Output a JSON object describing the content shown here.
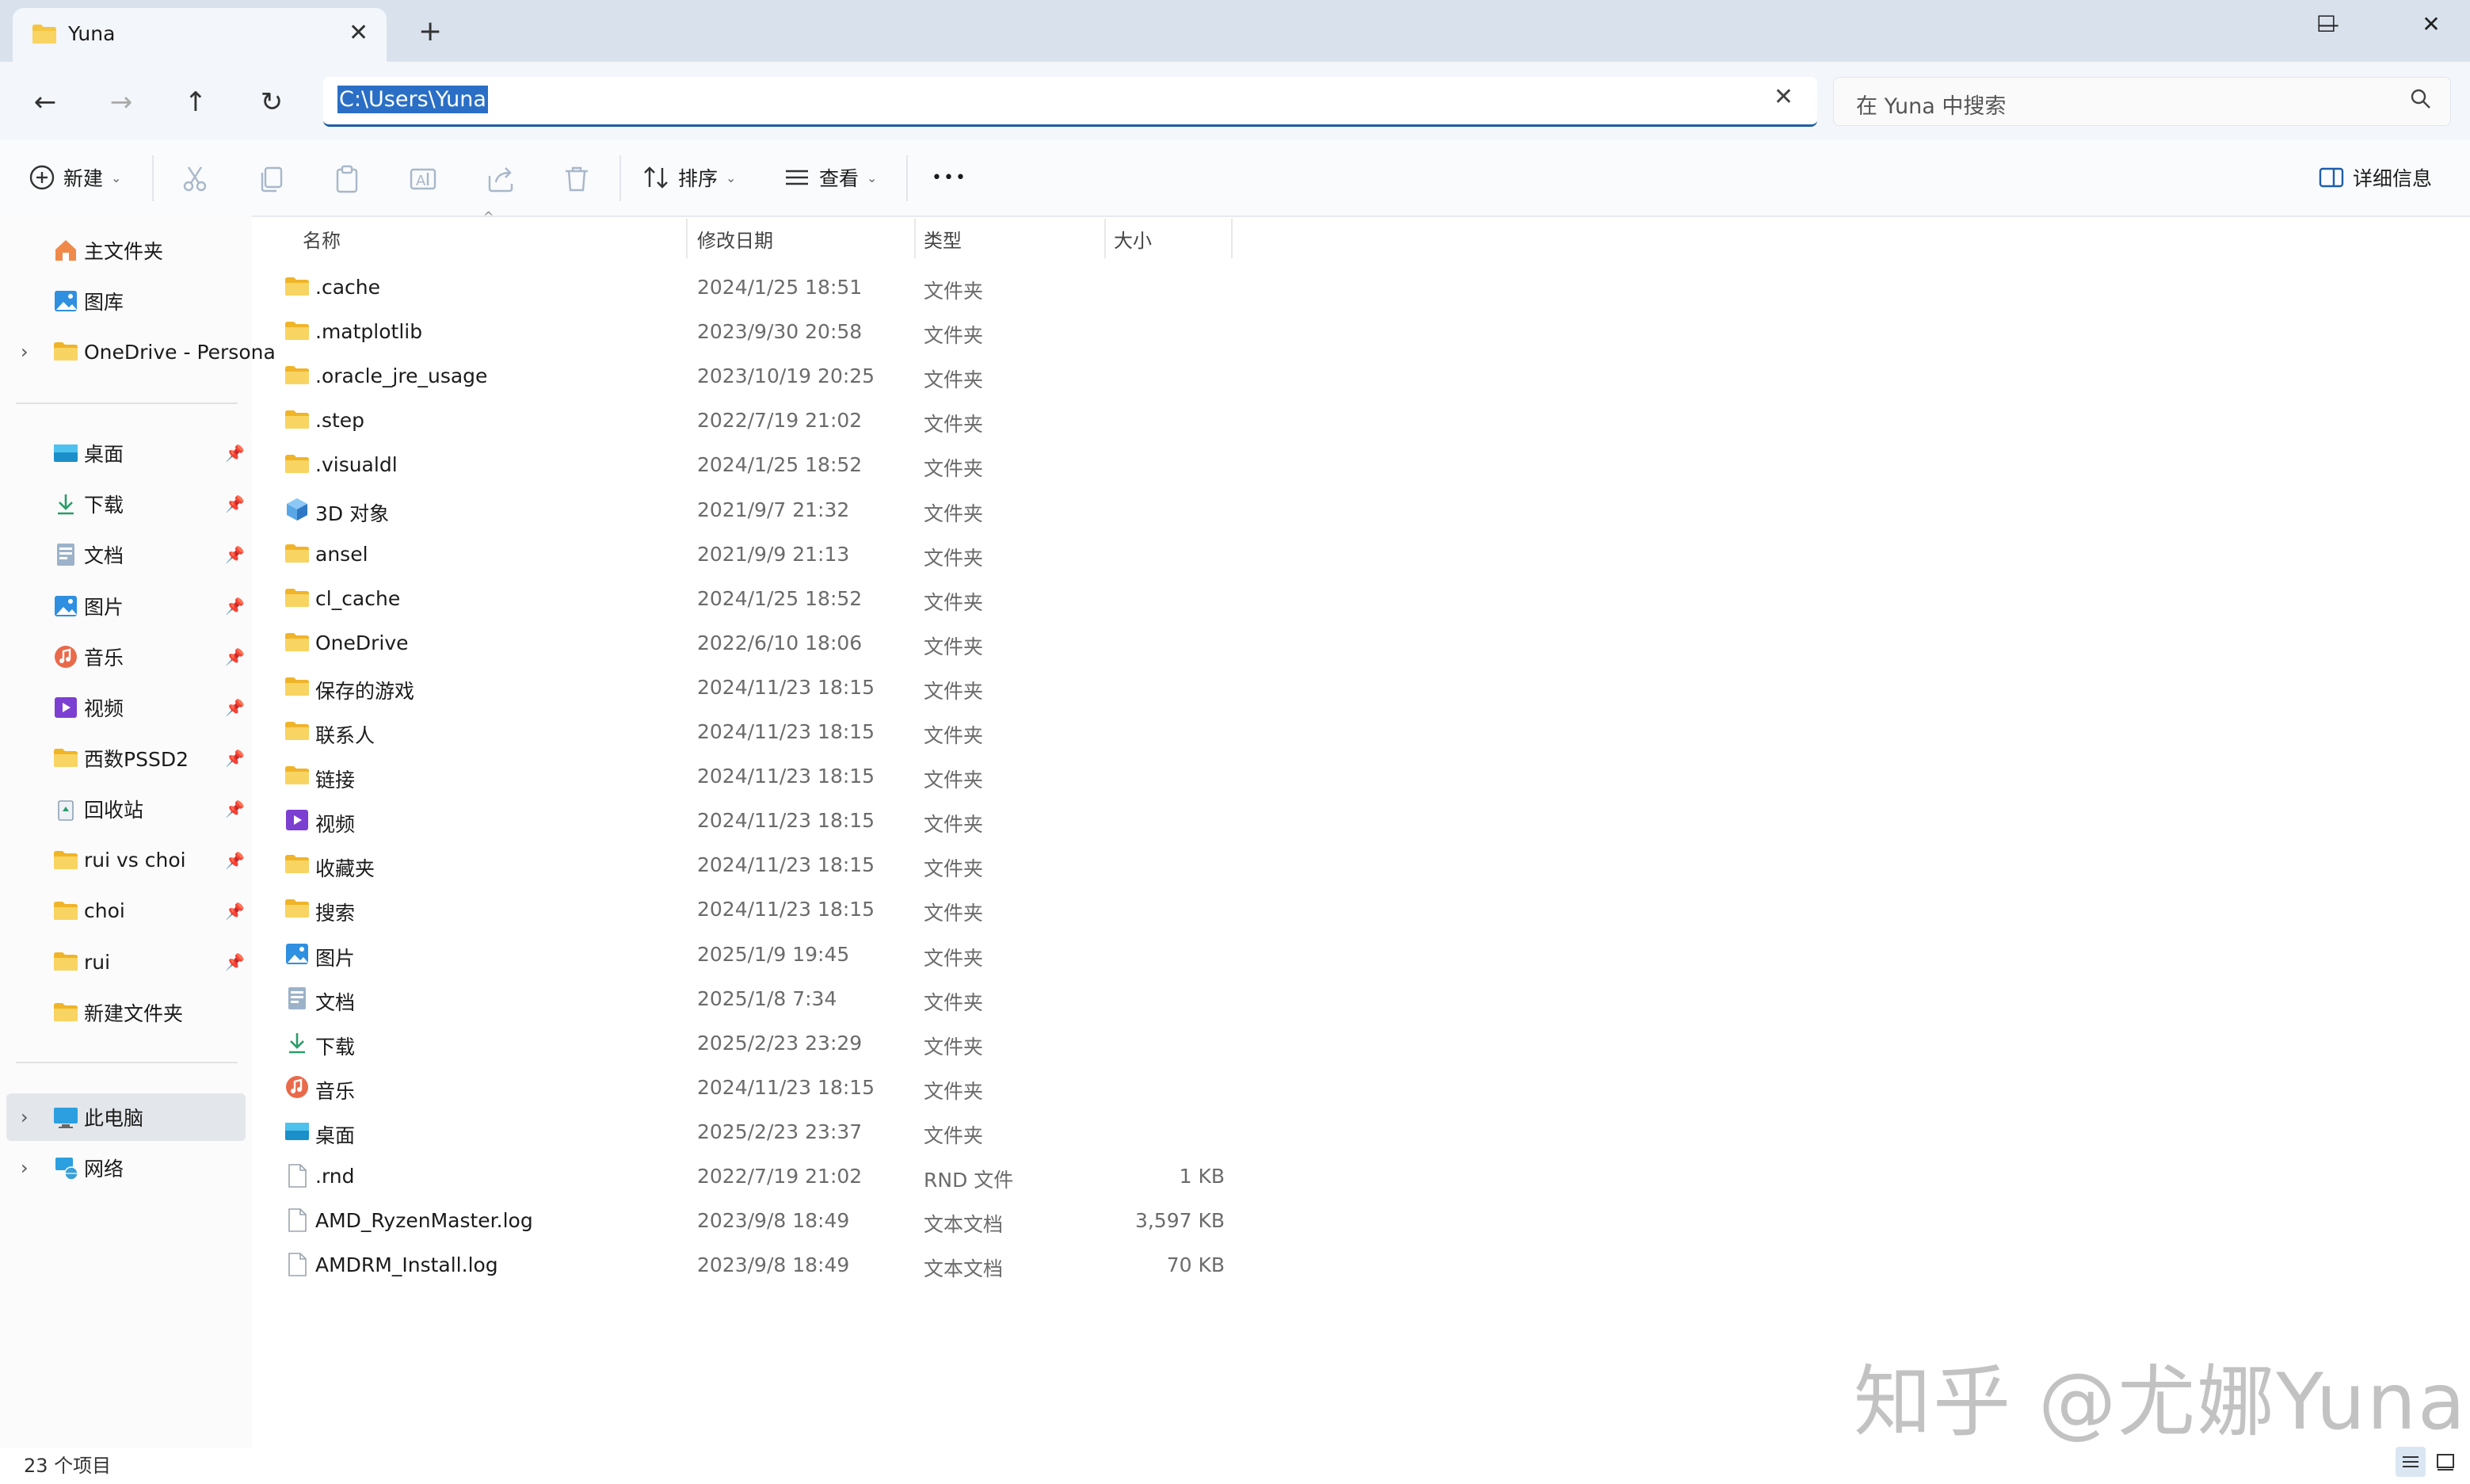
{
  "window": {
    "tab_title": "Yuna",
    "new_tab": "+",
    "tab_close": "✕",
    "minimize": "—",
    "maximize": "☐",
    "close": "✕"
  },
  "address": {
    "path": "C:\\Users\\Yuna",
    "clear": "✕",
    "search_placeholder": "在 Yuna 中搜索"
  },
  "nav": {
    "back": "←",
    "forward": "→",
    "up": "↑",
    "refresh": "↻"
  },
  "toolbar": {
    "new_label": "新建",
    "sort_label": "排序",
    "view_label": "查看",
    "more": "•••",
    "details_label": "详细信息"
  },
  "sidebar": {
    "top": [
      {
        "label": "主文件夹",
        "icon": "home-icon"
      },
      {
        "label": "图库",
        "icon": "gallery-icon"
      },
      {
        "label": "OneDrive - Persona",
        "icon": "folder-icon"
      }
    ],
    "pinned": [
      {
        "label": "桌面",
        "icon": "desktop-icon"
      },
      {
        "label": "下载",
        "icon": "download-icon"
      },
      {
        "label": "文档",
        "icon": "document-icon"
      },
      {
        "label": "图片",
        "icon": "pictures-icon"
      },
      {
        "label": "音乐",
        "icon": "music-icon"
      },
      {
        "label": "视频",
        "icon": "video-icon"
      },
      {
        "label": "西数PSSD2",
        "icon": "folder-icon"
      },
      {
        "label": "回收站",
        "icon": "recycle-bin-icon"
      },
      {
        "label": "rui vs choi",
        "icon": "folder-icon"
      },
      {
        "label": "choi",
        "icon": "folder-icon"
      },
      {
        "label": "rui",
        "icon": "folder-icon"
      },
      {
        "label": "新建文件夹",
        "icon": "folder-icon"
      }
    ],
    "bottom": [
      {
        "label": "此电脑",
        "icon": "computer-icon"
      },
      {
        "label": "网络",
        "icon": "network-icon"
      }
    ]
  },
  "columns": {
    "name": "名称",
    "date": "修改日期",
    "type": "类型",
    "size": "大小"
  },
  "files": [
    {
      "name": ".cache",
      "date": "2024/1/25 18:51",
      "type": "文件夹",
      "size": "",
      "icon": "folder"
    },
    {
      "name": ".matplotlib",
      "date": "2023/9/30 20:58",
      "type": "文件夹",
      "size": "",
      "icon": "folder"
    },
    {
      "name": ".oracle_jre_usage",
      "date": "2023/10/19 20:25",
      "type": "文件夹",
      "size": "",
      "icon": "folder"
    },
    {
      "name": ".step",
      "date": "2022/7/19 21:02",
      "type": "文件夹",
      "size": "",
      "icon": "folder"
    },
    {
      "name": ".visualdl",
      "date": "2024/1/25 18:52",
      "type": "文件夹",
      "size": "",
      "icon": "folder"
    },
    {
      "name": "3D 对象",
      "date": "2021/9/7 21:32",
      "type": "文件夹",
      "size": "",
      "icon": "3d"
    },
    {
      "name": "ansel",
      "date": "2021/9/9 21:13",
      "type": "文件夹",
      "size": "",
      "icon": "folder"
    },
    {
      "name": "cl_cache",
      "date": "2024/1/25 18:52",
      "type": "文件夹",
      "size": "",
      "icon": "folder"
    },
    {
      "name": "OneDrive",
      "date": "2022/6/10 18:06",
      "type": "文件夹",
      "size": "",
      "icon": "folder"
    },
    {
      "name": "保存的游戏",
      "date": "2024/11/23 18:15",
      "type": "文件夹",
      "size": "",
      "icon": "folder"
    },
    {
      "name": "联系人",
      "date": "2024/11/23 18:15",
      "type": "文件夹",
      "size": "",
      "icon": "folder"
    },
    {
      "name": "链接",
      "date": "2024/11/23 18:15",
      "type": "文件夹",
      "size": "",
      "icon": "folder"
    },
    {
      "name": "视频",
      "date": "2024/11/23 18:15",
      "type": "文件夹",
      "size": "",
      "icon": "video"
    },
    {
      "name": "收藏夹",
      "date": "2024/11/23 18:15",
      "type": "文件夹",
      "size": "",
      "icon": "folder"
    },
    {
      "name": "搜索",
      "date": "2024/11/23 18:15",
      "type": "文件夹",
      "size": "",
      "icon": "folder"
    },
    {
      "name": "图片",
      "date": "2025/1/9 19:45",
      "type": "文件夹",
      "size": "",
      "icon": "pictures"
    },
    {
      "name": "文档",
      "date": "2025/1/8 7:34",
      "type": "文件夹",
      "size": "",
      "icon": "document"
    },
    {
      "name": "下载",
      "date": "2025/2/23 23:29",
      "type": "文件夹",
      "size": "",
      "icon": "download"
    },
    {
      "name": "音乐",
      "date": "2024/11/23 18:15",
      "type": "文件夹",
      "size": "",
      "icon": "music"
    },
    {
      "name": "桌面",
      "date": "2025/2/23 23:37",
      "type": "文件夹",
      "size": "",
      "icon": "desktop"
    },
    {
      "name": ".rnd",
      "date": "2022/7/19 21:02",
      "type": "RND 文件",
      "size": "1 KB",
      "icon": "file"
    },
    {
      "name": "AMD_RyzenMaster.log",
      "date": "2023/9/8 18:49",
      "type": "文本文档",
      "size": "3,597 KB",
      "icon": "file"
    },
    {
      "name": "AMDRM_Install.log",
      "date": "2023/9/8 18:49",
      "type": "文本文档",
      "size": "70 KB",
      "icon": "file"
    }
  ],
  "status": {
    "count": "23 个项目"
  },
  "watermark": "知乎 @尤娜Yuna",
  "colors": {
    "accent": "#2a6fc5",
    "folder": "#f4c542",
    "titlebar": "#d9e2ec"
  }
}
